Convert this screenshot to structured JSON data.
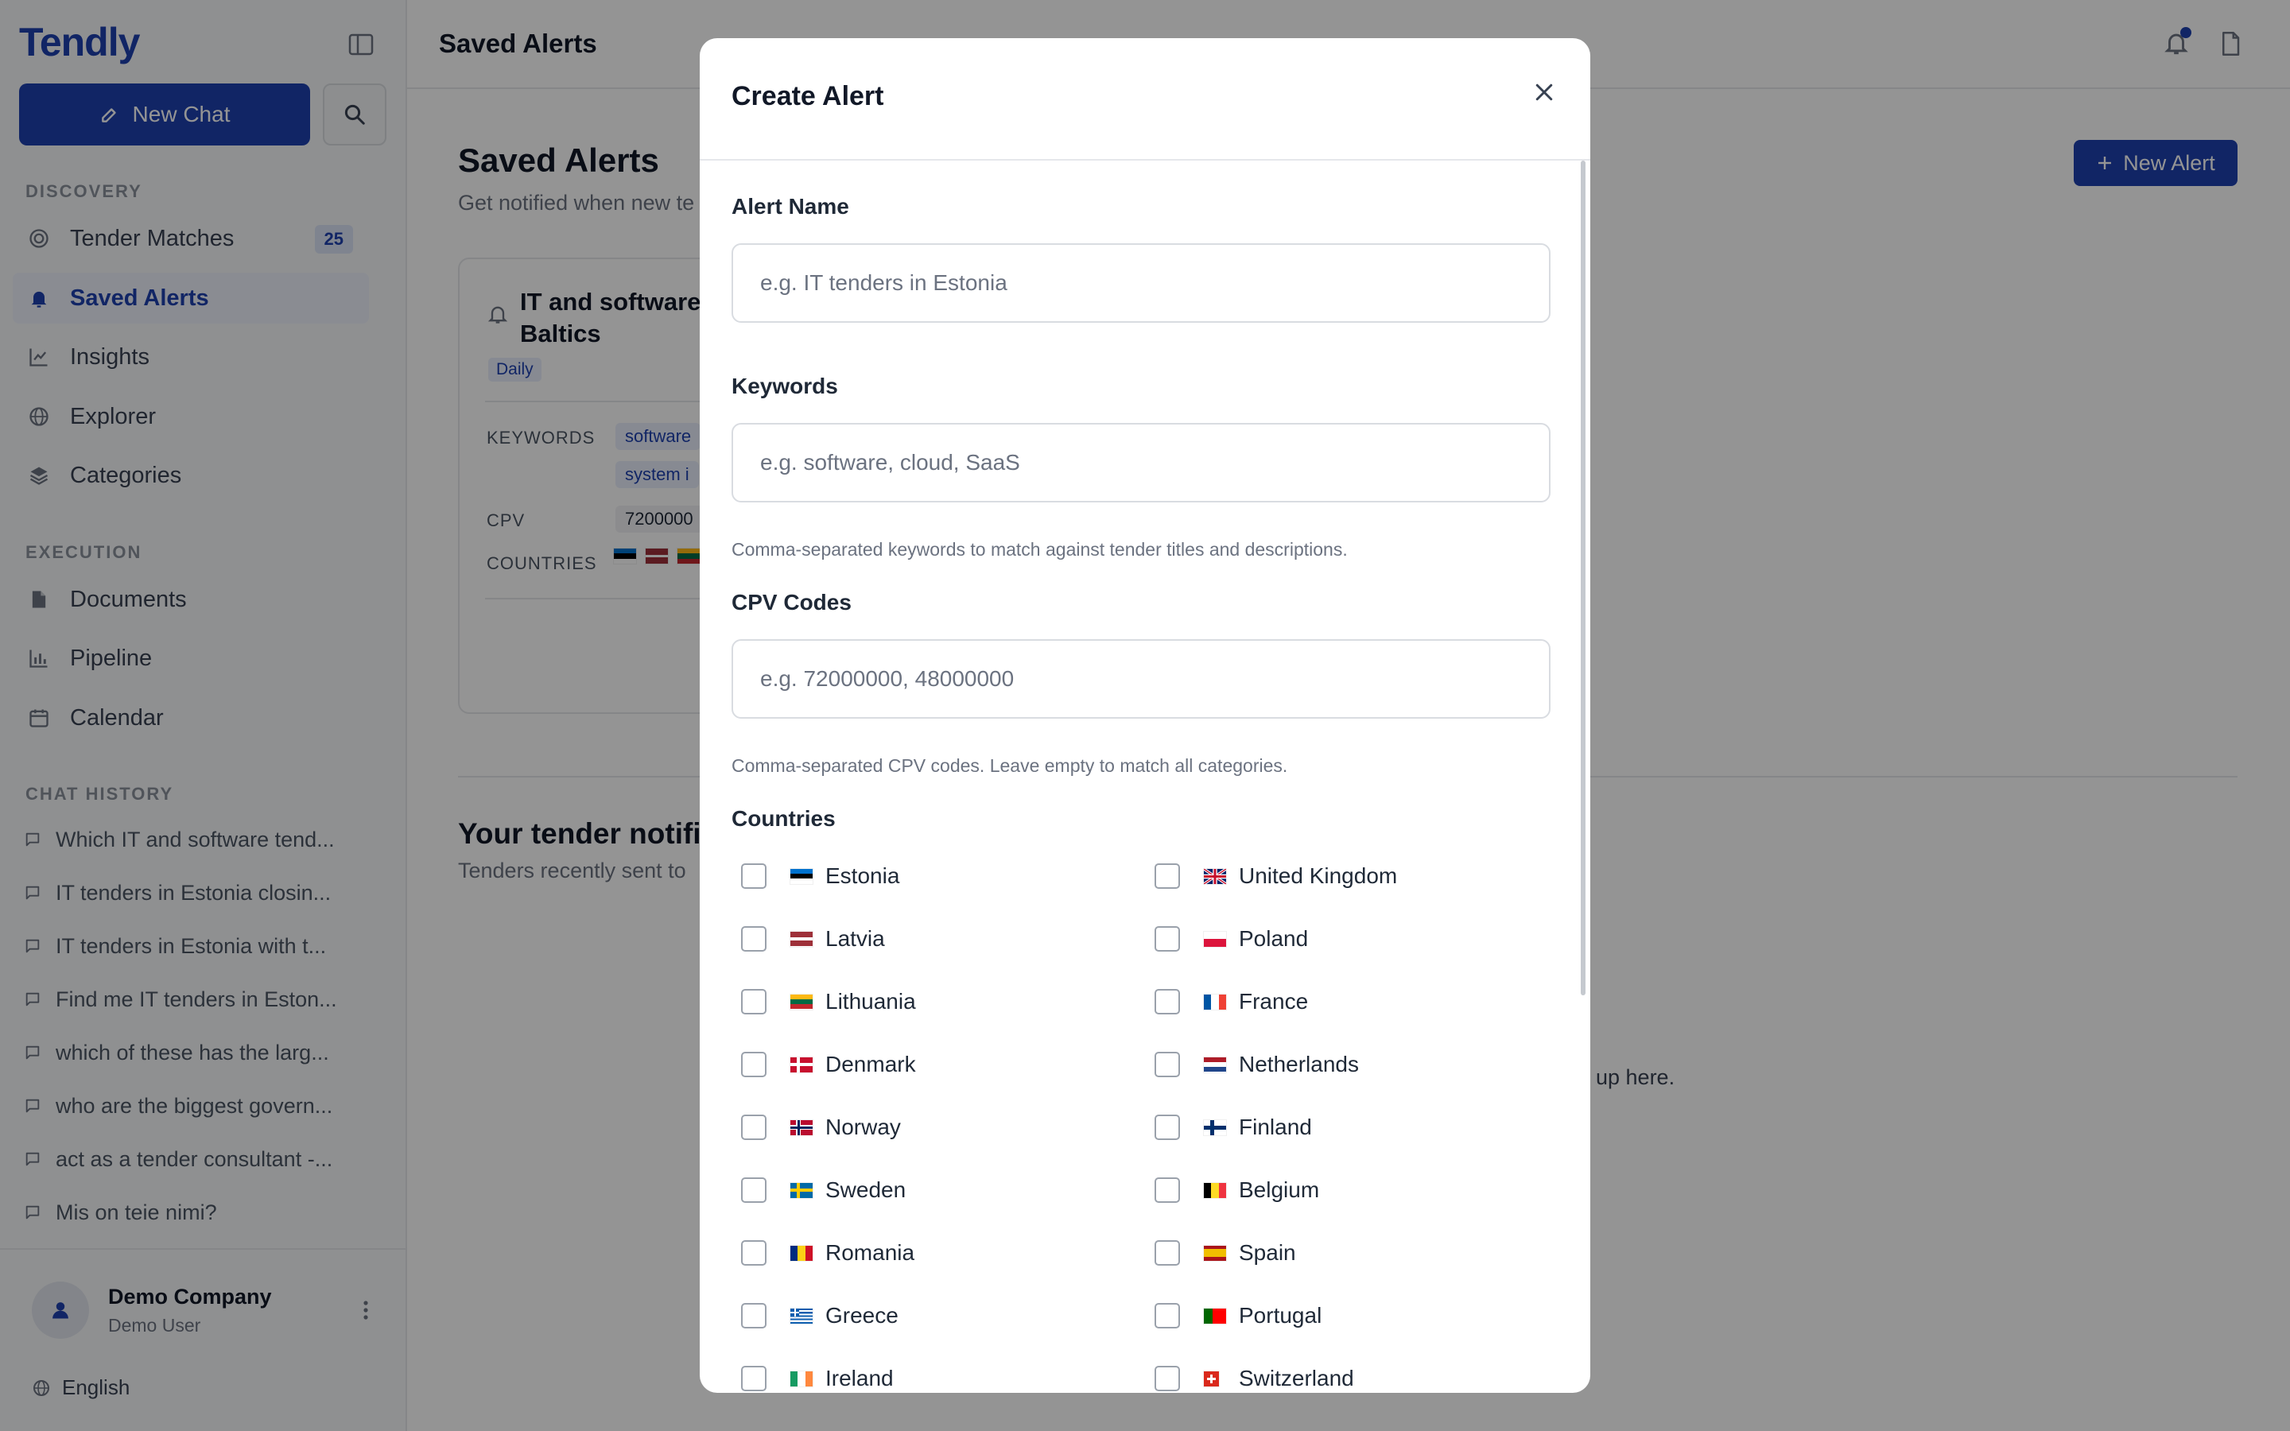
{
  "app": {
    "brand": "Tendly"
  },
  "sidebar": {
    "new_chat_label": "New Chat",
    "discovery_label": "DISCOVERY",
    "execution_label": "EXECUTION",
    "chat_history_label": "CHAT HISTORY",
    "nav": [
      {
        "label": "Tender Matches",
        "icon": "target-icon",
        "badge": "25"
      },
      {
        "label": "Saved Alerts",
        "icon": "bell-icon",
        "active": true
      },
      {
        "label": "Insights",
        "icon": "line-chart-icon"
      },
      {
        "label": "Explorer",
        "icon": "globe-icon"
      },
      {
        "label": "Categories",
        "icon": "layers-icon"
      },
      {
        "label": "Documents",
        "icon": "documents-icon"
      },
      {
        "label": "Pipeline",
        "icon": "bar-chart-icon"
      },
      {
        "label": "Calendar",
        "icon": "calendar-icon"
      }
    ],
    "chats": [
      "Which IT and software tend...",
      "IT tenders in Estonia closin...",
      "IT tenders in Estonia with t...",
      "Find me IT tenders in Eston...",
      "which of these has the larg...",
      "who are the biggest govern...",
      "act as a tender consultant -...",
      "Mis on teie nimi?"
    ],
    "footer": {
      "company": "Demo Company",
      "user": "Demo User",
      "language": "English"
    }
  },
  "main": {
    "topbar_title": "Saved Alerts",
    "page_title": "Saved Alerts",
    "page_subtitle": "Get notified when new te",
    "new_alert_label": "New Alert",
    "alert_card": {
      "title": "IT and software\nBaltics",
      "frequency": "Daily",
      "keywords_label": "KEYWORDS",
      "keywords": [
        "software",
        "system i"
      ],
      "cpv_label": "CPV",
      "cpv": "7200000",
      "countries_label": "COUNTRIES"
    },
    "notifications_title": "Your tender notific",
    "notifications_subtitle": "Tenders recently sent to",
    "empty_tail": "w up here."
  },
  "modal": {
    "title": "Create Alert",
    "alert_name": {
      "label": "Alert Name",
      "placeholder": "e.g. IT tenders in Estonia",
      "value": ""
    },
    "keywords": {
      "label": "Keywords",
      "placeholder": "e.g. software, cloud, SaaS",
      "value": "",
      "hint": "Comma-separated keywords to match against tender titles and descriptions."
    },
    "cpv": {
      "label": "CPV Codes",
      "placeholder": "e.g. 72000000, 48000000",
      "value": "",
      "hint": "Comma-separated CPV codes. Leave empty to match all categories."
    },
    "countries_label": "Countries",
    "countries_left": [
      "Estonia",
      "Latvia",
      "Lithuania",
      "Denmark",
      "Norway",
      "Sweden",
      "Romania",
      "Greece",
      "Ireland"
    ],
    "countries_right": [
      "United Kingdom",
      "Poland",
      "France",
      "Netherlands",
      "Finland",
      "Belgium",
      "Spain",
      "Portugal",
      "Switzerland"
    ]
  },
  "colors": {
    "accent": "#1e40af",
    "overlay": "rgba(0,0,0,0.42)"
  }
}
